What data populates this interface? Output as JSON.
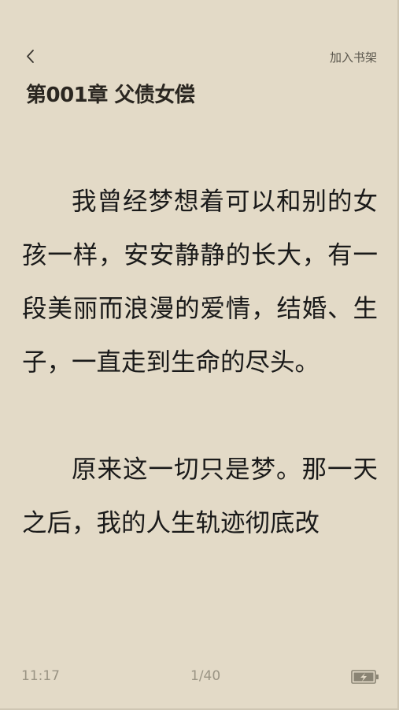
{
  "header": {
    "back_icon": "chevron-left-icon",
    "add_to_shelf_label": "加入书架"
  },
  "chapter": {
    "title": "第001章 父债女偿",
    "paragraphs": [
      "我曾经梦想着可以和别的女孩一样，安安静静的长大，有一段美丽而浪漫的爱情，结婚、生子，一直走到生命的尽头。",
      "原来这一切只是梦。那一天之后，我的人生轨迹彻底改"
    ]
  },
  "footer": {
    "time": "11:17",
    "page_indicator": "1/40",
    "battery_icon": "battery-charging-icon"
  },
  "colors": {
    "background": "#e3dac7",
    "text": "#1a1a1a",
    "muted": "#9a9484"
  }
}
